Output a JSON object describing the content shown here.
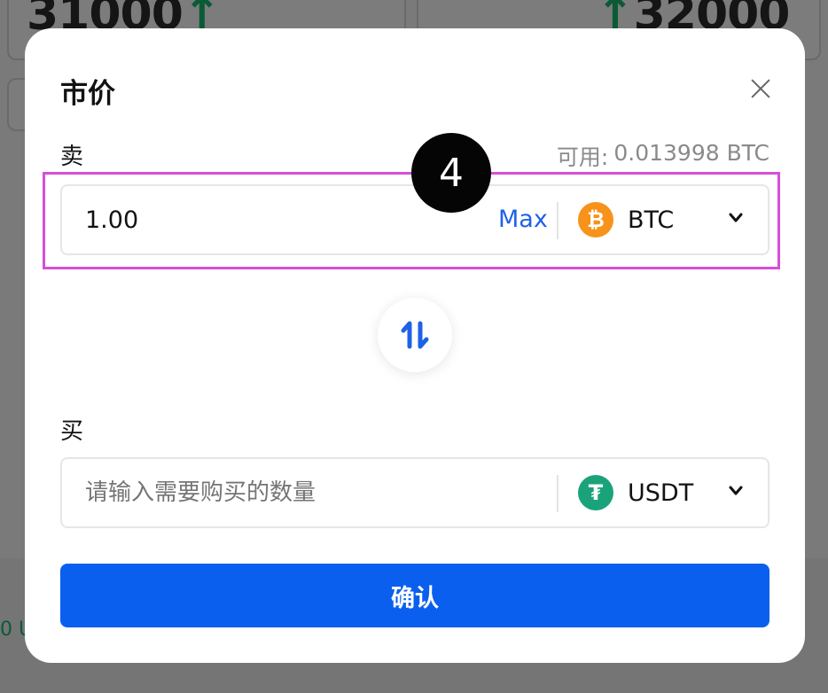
{
  "background": {
    "price_left": "31000",
    "price_right": "32000",
    "bottom_fragment": "0 U"
  },
  "modal": {
    "title": "市价",
    "close_icon": "close-icon",
    "sell": {
      "label": "卖",
      "available_label": "可用:",
      "available_value": "0.013998 BTC",
      "amount": "1.00",
      "max_label": "Max",
      "coin": "BTC",
      "coin_icon": "bitcoin-icon"
    },
    "swap_icon": "swap-arrows-icon",
    "buy": {
      "label": "买",
      "placeholder": "请输入需要购买的数量",
      "coin": "USDT",
      "coin_icon": "tether-icon"
    },
    "confirm_label": "确认"
  },
  "annotation": {
    "step_number": "4",
    "highlight_color": "#d64fd8"
  },
  "colors": {
    "accent": "#0a5fee",
    "link": "#1f62e6",
    "btc": "#f7931a",
    "usdt": "#1aa37a",
    "bg_up": "#0b5a36"
  }
}
